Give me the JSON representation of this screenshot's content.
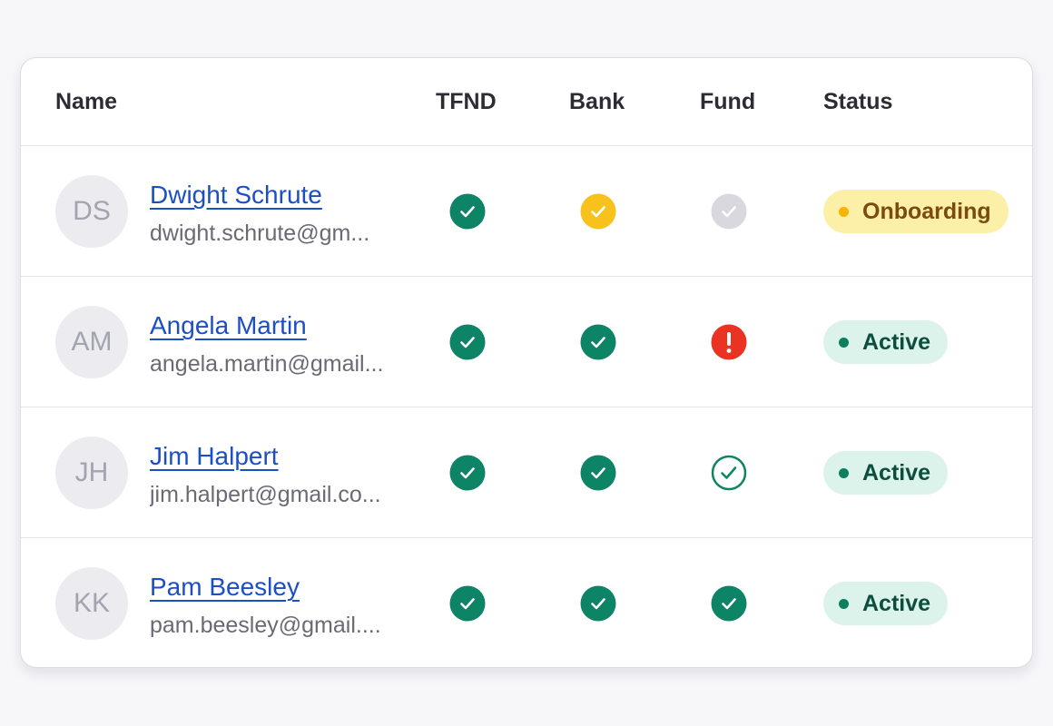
{
  "table": {
    "columns": {
      "name": "Name",
      "tfnd": "TFND",
      "bank": "Bank",
      "fund": "Fund",
      "status": "Status"
    },
    "rows": [
      {
        "initials": "DS",
        "name": "Dwight Schrute",
        "email": "dwight.schrute@gm...",
        "tfnd": "complete",
        "bank": "pending",
        "fund": "not-started",
        "status": "Onboarding"
      },
      {
        "initials": "AM",
        "name": "Angela Martin",
        "email": "angela.martin@gmail...",
        "tfnd": "complete",
        "bank": "complete",
        "fund": "error",
        "status": "Active"
      },
      {
        "initials": "JH",
        "name": "Jim Halpert",
        "email": "jim.halpert@gmail.co...",
        "tfnd": "complete",
        "bank": "complete",
        "fund": "verified-outline",
        "status": "Active"
      },
      {
        "initials": "KK",
        "name": "Pam Beesley",
        "email": "pam.beesley@gmail....",
        "tfnd": "complete",
        "bank": "complete",
        "fund": "complete",
        "status": "Active"
      }
    ]
  },
  "icons": {
    "complete": "check-circle-filled-icon",
    "pending": "check-circle-pending-icon",
    "not-started": "check-circle-inactive-icon",
    "error": "alert-circle-icon",
    "verified-outline": "check-circle-outline-icon"
  },
  "colors": {
    "complete": "#0e8466",
    "pending": "#f7c21b",
    "not_started": "#d8d8de",
    "error": "#ea3323",
    "link": "#1d4fc4"
  }
}
